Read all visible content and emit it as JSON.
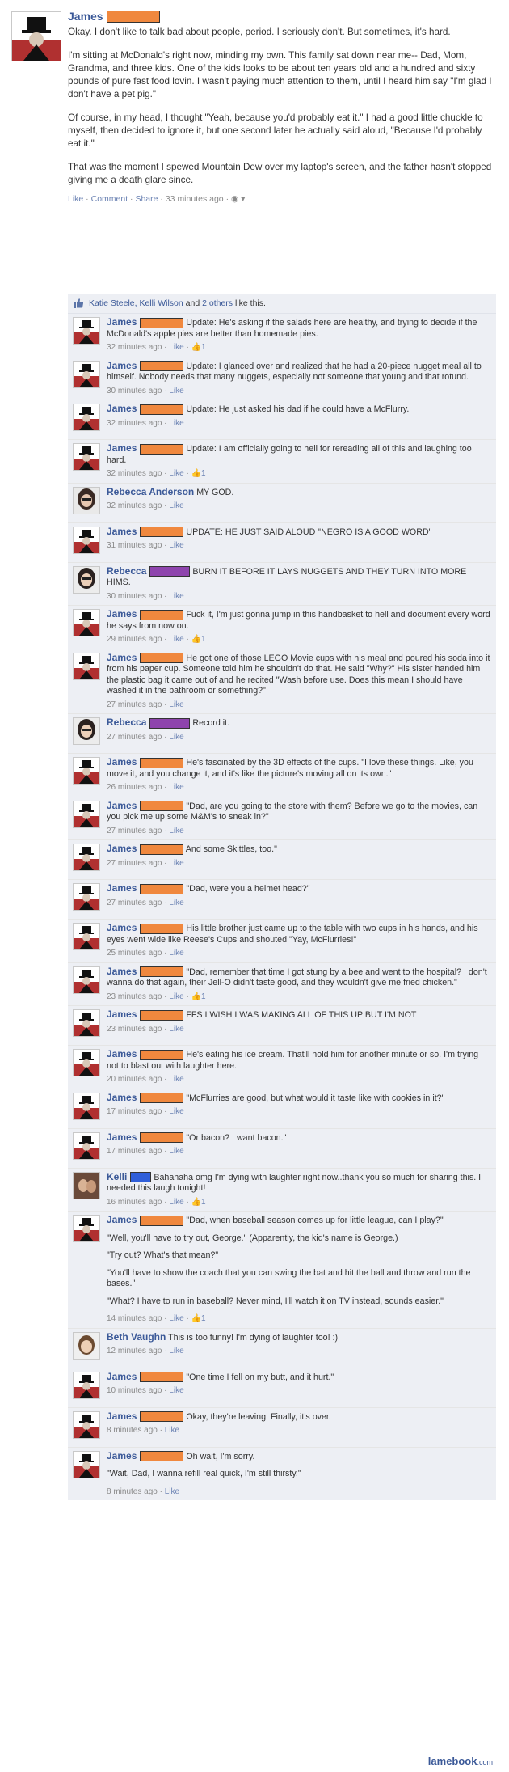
{
  "post": {
    "author": "James",
    "paragraphs": [
      "Okay. I don't like to talk bad about people, period. I seriously don't. But sometimes, it's hard.",
      "I'm sitting at McDonald's right now, minding my own. This family sat down near me-- Dad, Mom, Grandma, and three kids. One of the kids looks to be about ten years old and a hundred and sixty pounds of pure fast food lovin. I wasn't paying much attention to them, until I heard him say \"I'm glad I don't have a pet pig.\"",
      "Of course, in my head, I thought \"Yeah, because you'd probably eat it.\" I had a good little chuckle to myself, then decided to ignore it, but one second later he actually said aloud, \"Because I'd probably eat it.\"",
      "That was the moment I spewed Mountain Dew over my laptop's screen, and the father hasn't stopped giving me a death glare since."
    ],
    "meta": {
      "like": "Like",
      "comment": "Comment",
      "share": "Share",
      "time": "33 minutes ago"
    }
  },
  "likes": {
    "names": "Katie Steele, Kelli Wilson",
    "and": "and",
    "others": "2 others",
    "suffix": "like this."
  },
  "comments": [
    {
      "author": "James",
      "redact": "orange",
      "avatar": "top",
      "text": "Update: He's asking if the salads here are healthy, and trying to decide if the McDonald's apple pies are better than homemade pies.",
      "time": "32 minutes ago",
      "likes": "1"
    },
    {
      "author": "James",
      "redact": "orange",
      "avatar": "top",
      "text": "Update: I glanced over and realized that he had a 20-piece nugget meal all to himself. Nobody needs that many nuggets, especially not someone that young and that rotund.",
      "time": "30 minutes ago"
    },
    {
      "author": "James",
      "redact": "orange",
      "avatar": "top",
      "text": "Update: He just asked his dad if he could have a McFlurry.",
      "time": "32 minutes ago"
    },
    {
      "author": "James",
      "redact": "orange",
      "avatar": "top",
      "text": "Update: I am officially going to hell for rereading all of this and laughing too hard.",
      "time": "32 minutes ago",
      "likes": "1"
    },
    {
      "author": "Rebecca Anderson",
      "avatar": "girl",
      "text": "MY GOD.",
      "time": "32 minutes ago"
    },
    {
      "author": "James",
      "redact": "orange",
      "avatar": "top",
      "text": "UPDATE: HE JUST SAID ALOUD \"NEGRO IS A GOOD WORD\"",
      "time": "31 minutes ago"
    },
    {
      "author": "Rebecca",
      "redact": "purple",
      "avatar": "girl2",
      "text": "BURN IT BEFORE IT LAYS NUGGETS AND THEY TURN INTO MORE HIMS.",
      "time": "30 minutes ago"
    },
    {
      "author": "James",
      "redact": "orange",
      "avatar": "top",
      "text": "Fuck it, I'm just gonna jump in this handbasket to hell and document every word he says from now on.",
      "time": "29 minutes ago",
      "likes": "1"
    },
    {
      "author": "James",
      "redact": "orange",
      "avatar": "top",
      "text": "He got one of those LEGO Movie cups with his meal and poured his soda into it from his paper cup. Someone told him he shouldn't do that. He said \"Why?\" His sister handed him the plastic bag it came out of and he recited \"Wash before use. Does this mean I should have washed it in the bathroom or something?\"",
      "time": "27 minutes ago"
    },
    {
      "author": "Rebecca",
      "redact": "purple",
      "avatar": "girl2",
      "text": "Record it.",
      "time": "27 minutes ago"
    },
    {
      "author": "James",
      "redact": "orange",
      "avatar": "top",
      "text": "He's fascinated by the 3D effects of the cups. \"I love these things. Like, you move it, and you change it, and it's like the picture's moving all on its own.\"",
      "time": "26 minutes ago"
    },
    {
      "author": "James",
      "redact": "orange",
      "avatar": "top",
      "text": "\"Dad, are you going to the store with them? Before we go to the movies, can you pick me up some M&M's to sneak in?\"",
      "time": "27 minutes ago"
    },
    {
      "author": "James",
      "redact": "orange",
      "avatar": "top",
      "text": "And some Skittles, too.\"",
      "time": "27 minutes ago"
    },
    {
      "author": "James",
      "redact": "orange",
      "avatar": "top",
      "text": "\"Dad, were you a helmet head?\"",
      "time": "27 minutes ago"
    },
    {
      "author": "James",
      "redact": "orange",
      "avatar": "top",
      "text": "His little brother just came up to the table with two cups in his hands, and his eyes went wide like Reese's Cups and shouted \"Yay, McFlurries!\"",
      "time": "25 minutes ago"
    },
    {
      "author": "James",
      "redact": "orange",
      "avatar": "top",
      "text": "\"Dad, remember that time I got stung by a bee and went to the hospital? I don't wanna do that again, their Jell-O didn't taste good, and they wouldn't give me fried chicken.\"",
      "time": "23 minutes ago",
      "likes": "1"
    },
    {
      "author": "James",
      "redact": "orange",
      "avatar": "top",
      "text": "FFS I WISH I WAS MAKING ALL OF THIS UP BUT I'M NOT",
      "time": "23 minutes ago"
    },
    {
      "author": "James",
      "redact": "orange",
      "avatar": "top",
      "text": "He's eating his ice cream. That'll hold him for another minute or so. I'm trying not to blast out with laughter here.",
      "time": "20 minutes ago"
    },
    {
      "author": "James",
      "redact": "orange",
      "avatar": "top",
      "text": "\"McFlurries are good, but what would it taste like with cookies in it?\"",
      "time": "17 minutes ago"
    },
    {
      "author": "James",
      "redact": "orange",
      "avatar": "top",
      "text": "\"Or bacon? I want bacon.\"",
      "time": "17 minutes ago"
    },
    {
      "author": "Kelli",
      "redact": "blue",
      "avatar": "kelli",
      "text": "Bahahaha omg I'm dying with laughter right now..thank you so much for sharing this. I needed this laugh tonight!",
      "time": "16 minutes ago",
      "likes": "1"
    },
    {
      "author": "James",
      "redact": "orange",
      "avatar": "top",
      "paras": [
        "\"Dad, when baseball season comes up for little league, can I play?\"",
        "\"Well, you'll have to try out, George.\" (Apparently, the kid's name is George.)",
        "\"Try out? What's that mean?\"",
        "\"You'll have to show the coach that you can swing the bat and hit the ball and throw and run the bases.\"",
        "\"What? I have to run in baseball? Never mind, I'll watch it on TV instead, sounds easier.\""
      ],
      "time": "14 minutes ago",
      "likes": "1"
    },
    {
      "author": "Beth Vaughn",
      "avatar": "beth",
      "text": "This is too funny! I'm dying of laughter too! :)",
      "time": "12 minutes ago"
    },
    {
      "author": "James",
      "redact": "orange",
      "avatar": "top",
      "text": "\"One time I fell on my butt, and it hurt.\"",
      "time": "10 minutes ago"
    },
    {
      "author": "James",
      "redact": "orange",
      "avatar": "top",
      "text": "Okay, they're leaving. Finally, it's over.",
      "time": "8 minutes ago"
    },
    {
      "author": "James",
      "redact": "orange",
      "avatar": "top",
      "paras": [
        "Oh wait, I'm sorry.",
        "\"Wait, Dad, I wanna refill real quick, I'm still thirsty.\""
      ],
      "time": "8 minutes ago"
    }
  ],
  "ui": {
    "like": "Like",
    "sep": "·"
  },
  "brand": {
    "name": "lamebook",
    "tld": ".com"
  }
}
